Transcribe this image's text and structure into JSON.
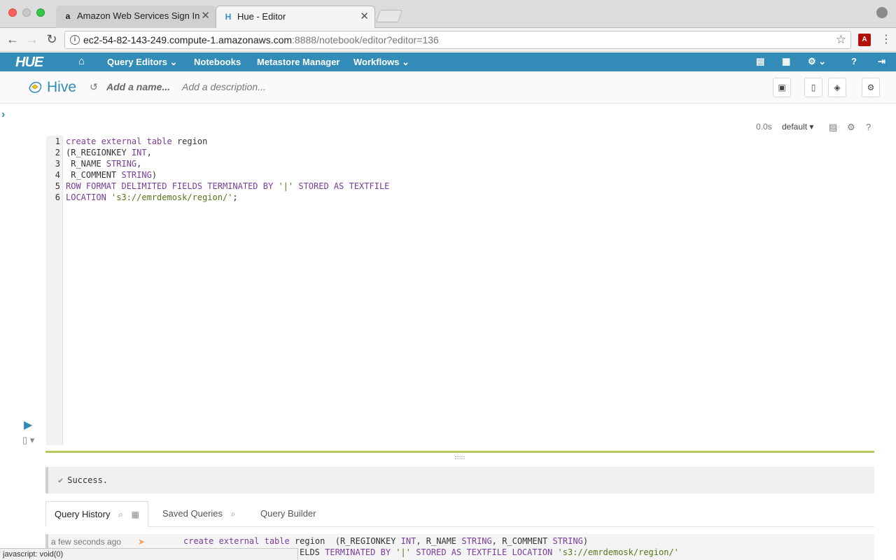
{
  "browser": {
    "tabs": [
      {
        "title": "Amazon Web Services Sign In",
        "favicon": "a",
        "active": false
      },
      {
        "title": "Hue - Editor",
        "favicon": "H",
        "active": true
      }
    ],
    "url_host": "ec2-54-82-143-249.compute-1.amazonaws.com",
    "url_path": ":8888/notebook/editor?editor=136",
    "status_link": "javascript: void(0)"
  },
  "hue_nav": {
    "logo": "HUE",
    "items": {
      "query_editors": "Query Editors",
      "notebooks": "Notebooks",
      "metastore": "Metastore Manager",
      "workflows": "Workflows"
    }
  },
  "editor_header": {
    "title": "Hive",
    "name_placeholder": "Add a name...",
    "description_placeholder": "Add a description..."
  },
  "snippet": {
    "exec_time": "0.0s",
    "database": "default",
    "line_numbers": [
      "1",
      "2",
      "3",
      "4",
      "5",
      "6"
    ],
    "status": "Success."
  },
  "bottom_tabs": {
    "history": "Query History",
    "saved": "Saved Queries",
    "builder": "Query Builder"
  },
  "history_row": {
    "time": "a few seconds ago",
    "line1_prefix": "create external table region  (R_REGIONKEY INT, R_NAME STRING, R_COMMENT STRING)",
    "line2": "ELDS TERMINATED BY '|' STORED AS TEXTFILE LOCATION 's3://emrdemosk/region/'"
  },
  "colors": {
    "hue_blue": "#338bb8",
    "resizer_green": "#b5cc5a",
    "keyword": "#7a3d99",
    "string": "#55761a"
  }
}
